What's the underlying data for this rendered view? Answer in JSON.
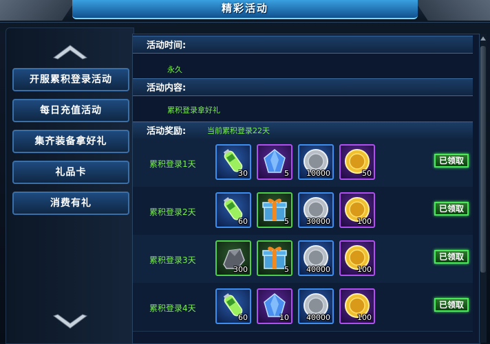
{
  "window": {
    "title": "精彩活动"
  },
  "menu": [
    {
      "label": "开服累积登录活动",
      "active": true
    },
    {
      "label": "每日充值活动",
      "active": false
    },
    {
      "label": "集齐装备拿好礼",
      "active": false
    },
    {
      "label": "礼品卡",
      "active": false
    },
    {
      "label": "消费有礼",
      "active": false
    }
  ],
  "activity": {
    "time_label": "活动时间:",
    "time_value": "永久",
    "content_label": "活动内容:",
    "content_value": "累积登录拿好礼",
    "reward_label": "活动奖励:",
    "reward_note": "当前累积登录22天"
  },
  "rewards": [
    {
      "label": "累积登录1天",
      "button": "已领取",
      "items": [
        {
          "icon": "green-potion-icon",
          "frame": "blue",
          "qty": "30"
        },
        {
          "icon": "blue-crystal-icon",
          "frame": "purple",
          "qty": "5"
        },
        {
          "icon": "silver-coin-icon",
          "frame": "blue",
          "qty": "10000"
        },
        {
          "icon": "gold-coin-icon",
          "frame": "purple",
          "qty": "50"
        }
      ]
    },
    {
      "label": "累积登录2天",
      "button": "已领取",
      "items": [
        {
          "icon": "green-potion-icon",
          "frame": "blue",
          "qty": "60"
        },
        {
          "icon": "gift-box-icon",
          "frame": "green",
          "qty": "5"
        },
        {
          "icon": "silver-coin-icon",
          "frame": "blue",
          "qty": "30000"
        },
        {
          "icon": "gold-coin-icon",
          "frame": "purple",
          "qty": "100"
        }
      ]
    },
    {
      "label": "累积登录3天",
      "button": "已领取",
      "items": [
        {
          "icon": "iron-ore-icon",
          "frame": "green",
          "qty": "300"
        },
        {
          "icon": "gift-box-icon",
          "frame": "green",
          "qty": "5"
        },
        {
          "icon": "silver-coin-icon",
          "frame": "blue",
          "qty": "40000"
        },
        {
          "icon": "gold-coin-icon",
          "frame": "purple",
          "qty": "100"
        }
      ]
    },
    {
      "label": "累积登录4天",
      "button": "已领取",
      "items": [
        {
          "icon": "green-potion-icon",
          "frame": "blue",
          "qty": "60"
        },
        {
          "icon": "blue-crystal-icon",
          "frame": "purple",
          "qty": "10"
        },
        {
          "icon": "silver-coin-icon",
          "frame": "blue",
          "qty": "40000"
        },
        {
          "icon": "gold-coin-icon",
          "frame": "purple",
          "qty": "100"
        }
      ]
    }
  ],
  "colors": {
    "accent_green": "#7cf050",
    "title_blue": "#3aa0e0",
    "active_gold": "#e5c24a"
  }
}
